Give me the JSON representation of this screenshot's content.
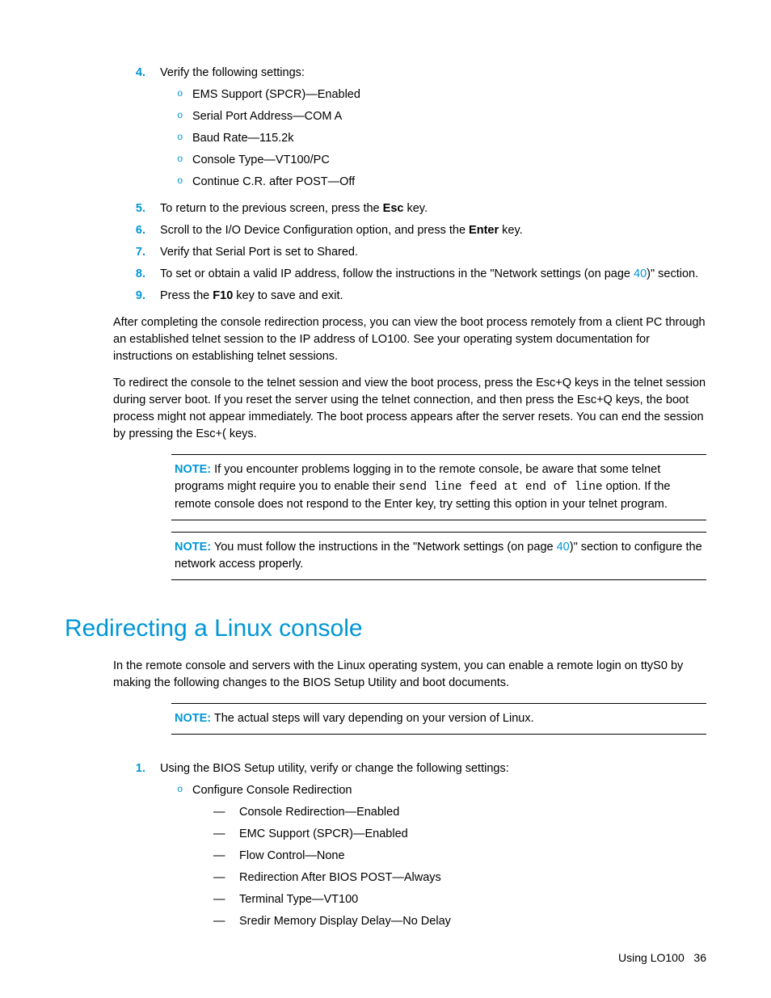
{
  "steps_a": {
    "s4": {
      "num": "4.",
      "text": "Verify the following settings:",
      "subs": [
        "EMS Support (SPCR)—Enabled",
        "Serial Port Address—COM A",
        "Baud Rate—115.2k",
        "Console Type—VT100/PC",
        "Continue C.R. after POST—Off"
      ]
    },
    "s5": {
      "num": "5.",
      "pre": "To return to the previous screen, press the ",
      "bold": "Esc",
      "post": " key."
    },
    "s6": {
      "num": "6.",
      "pre": "Scroll to the I/O Device Configuration option, and press the ",
      "bold": "Enter",
      "post": " key."
    },
    "s7": {
      "num": "7.",
      "text": "Verify that Serial Port is set to Shared."
    },
    "s8": {
      "num": "8.",
      "pre": "To set or obtain a valid IP address, follow the instructions in the \"Network settings (on page ",
      "link": "40",
      "post": ")\" section."
    },
    "s9": {
      "num": "9.",
      "pre": "Press the ",
      "bold": "F10",
      "post": " key to save and exit."
    }
  },
  "para1": "After completing the console redirection process, you can view the boot process remotely from a client PC through an established telnet session to the IP address of LO100. See your operating system documentation for instructions on establishing telnet sessions.",
  "para2": "To redirect the console to the telnet session and view the boot process, press the Esc+Q keys in the telnet session during server boot. If you reset the server using the telnet connection, and then press the Esc+Q keys, the boot process might not appear immediately. The boot process appears after the server resets. You can end the session by pressing the Esc+( keys.",
  "note1": {
    "label": "NOTE:",
    "pre": "  If you encounter problems logging in to the remote console, be aware that some telnet programs might require you to enable their ",
    "mono": "send line feed at end of line",
    "post": " option. If the remote console does not respond to the Enter key, try setting this option in your telnet program."
  },
  "note2": {
    "label": "NOTE:",
    "pre": "  You must follow the instructions in the \"Network settings (on page ",
    "link": "40",
    "post": ")\" section to configure the network access properly."
  },
  "heading": "Redirecting a Linux console",
  "para3": "In the remote console and servers with the Linux operating system, you can enable a remote login on ttyS0 by making the following changes to the BIOS Setup Utility and boot documents.",
  "note3": {
    "label": "NOTE:",
    "text": "  The actual steps will vary depending on your version of Linux."
  },
  "steps_b": {
    "s1": {
      "num": "1.",
      "text": "Using the BIOS Setup utility, verify or change the following settings:",
      "sub_label": "Configure Console Redirection",
      "dashes": [
        "Console Redirection—Enabled",
        "EMC Support (SPCR)—Enabled",
        "Flow Control—None",
        "Redirection After BIOS POST—Always",
        "Terminal Type—VT100",
        "Sredir Memory Display Delay—No Delay"
      ]
    }
  },
  "footer": {
    "label": "Using LO100",
    "page": "36"
  },
  "glyph": {
    "circle": "o",
    "dash": "—"
  }
}
